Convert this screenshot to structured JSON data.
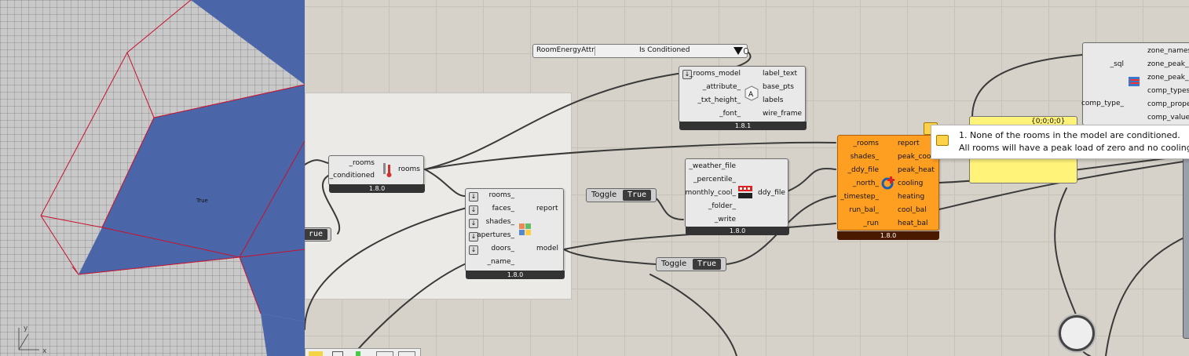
{
  "viewport": {
    "room_label": "True",
    "axis_x": "x",
    "axis_y": "y"
  },
  "canvas": {
    "value_list": {
      "name": "RoomEnergyAttr",
      "value": "Is Conditioned"
    },
    "comp_rooms_cond": {
      "inputs": [
        "_rooms",
        "_conditioned"
      ],
      "outputs": [
        "rooms"
      ],
      "version": "1.8.0"
    },
    "comp_model": {
      "inputs": [
        "rooms_",
        "faces_",
        "shades_",
        "apertures_",
        "doors_",
        "_name_"
      ],
      "outputs": [
        "report",
        "model"
      ],
      "version": "1.8.0"
    },
    "comp_label": {
      "inputs": [
        "_rooms_model",
        "_attribute_",
        "_txt_height_",
        "_font_"
      ],
      "outputs": [
        "label_text",
        "base_pts",
        "labels",
        "wire_frame"
      ],
      "version": "1.8.1"
    },
    "comp_ddy": {
      "inputs": [
        "_weather_file",
        "_percentile_",
        "monthly_cool_",
        "_folder_",
        "_write"
      ],
      "outputs": [
        "ddy_file"
      ],
      "version": "1.8.0"
    },
    "comp_peak": {
      "inputs": [
        "_rooms",
        "shades_",
        "_ddy_file",
        "_north_",
        "_timestep_",
        "run_bal_",
        "_run"
      ],
      "outputs": [
        "report",
        "peak_cool",
        "peak_heat",
        "cooling",
        "heating",
        "cool_bal",
        "heat_bal"
      ],
      "version": "1.8.0"
    },
    "comp_sql": {
      "inputs": [
        "_sql",
        "comp_type_"
      ],
      "outputs": [
        "zone_names",
        "zone_peak_co",
        "zone_peak_h",
        "comp_types",
        "comp_prope",
        "comp_values"
      ]
    },
    "toggle_left": {
      "value": "rue"
    },
    "toggle_1": {
      "label": "Toggle",
      "value": "True"
    },
    "toggle_2": {
      "label": "Toggle",
      "value": "True"
    },
    "panel": {
      "text": "{0;0;0;0}"
    },
    "tooltip": {
      "line1": "1. None of the rooms in the model are conditioned.",
      "line2": "All rooms will have a peak load of zero and no cooling o"
    },
    "colors": {
      "orange": "#ff9f21",
      "panel": "#fff37a",
      "room_blue": "#4a66a8",
      "edge_red": "#c8102e"
    }
  }
}
